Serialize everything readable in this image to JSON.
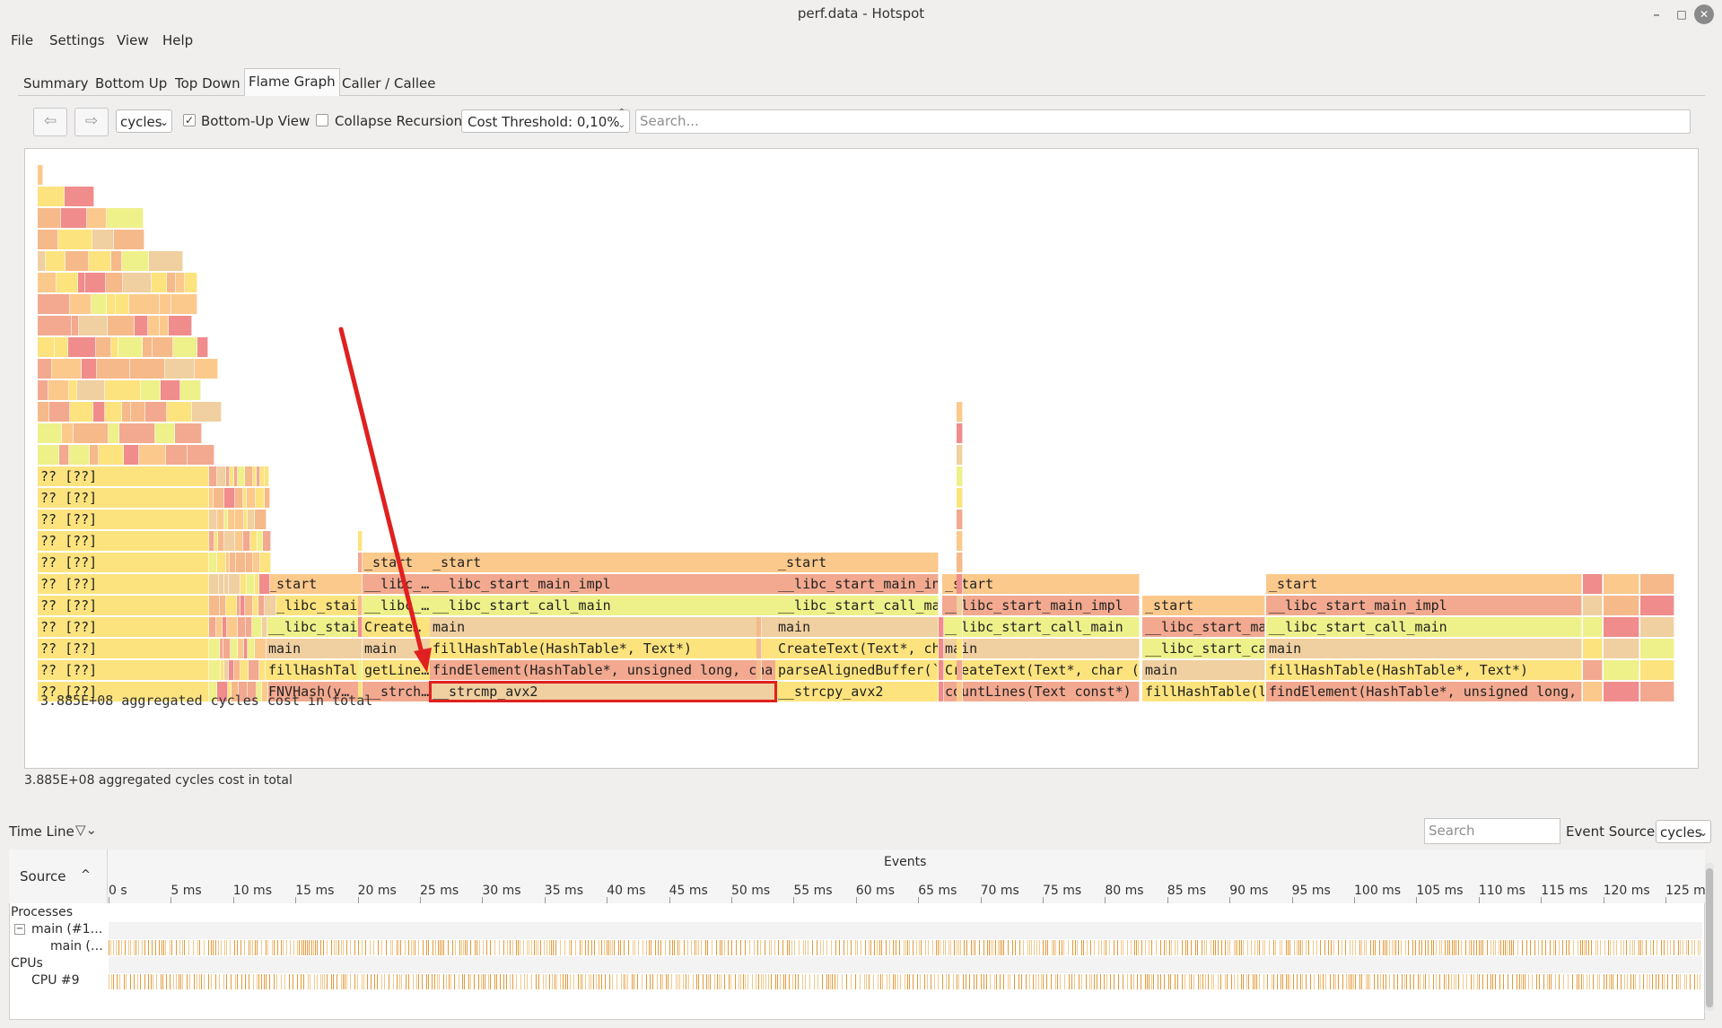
{
  "window": {
    "title": "perf.data - Hotspot",
    "minimize": "–",
    "maximize": "□",
    "close": "✕"
  },
  "menu": [
    "File",
    "Settings",
    "View",
    "Help"
  ],
  "tabs": [
    "Summary",
    "Bottom Up",
    "Top Down",
    "Flame Graph",
    "Caller / Callee"
  ],
  "active_tab": "Flame Graph",
  "toolbar": {
    "back_icon": "⇦",
    "forward_icon": "⇨",
    "event_type": "cycles",
    "bottom_up_view": {
      "label": "Bottom-Up View",
      "checked": true
    },
    "collapse_recursion": {
      "label": "Collapse Recursion",
      "checked": false
    },
    "cost_threshold": "Cost Threshold: 0,10%",
    "search_placeholder": "Search..."
  },
  "flamegraph": {
    "total_inline": "3.885E+08 aggregated cycles cost in total",
    "status": "3.885E+08 aggregated cycles cost in total",
    "colors": {
      "orange": "#fcc98c",
      "salmon": "#f2a98f",
      "yellow": "#fce37e",
      "lime": "#eef08a",
      "tan": "#f0cfa0",
      "red": "#f08c8c",
      "peach": "#f6b98a"
    },
    "frames": [
      {
        "col": 0,
        "row": 0,
        "label": "?? [??]",
        "c": "yellow"
      },
      {
        "col": 0,
        "row": 1,
        "label": "?? [??]",
        "c": "yellow"
      },
      {
        "col": 0,
        "row": 2,
        "label": "?? [??]",
        "c": "yellow"
      },
      {
        "col": 0,
        "row": 3,
        "label": "?? [??]",
        "c": "yellow"
      },
      {
        "col": 0,
        "row": 4,
        "label": "?? [??]",
        "c": "yellow"
      },
      {
        "col": 0,
        "row": 5,
        "label": "?? [??]",
        "c": "yellow"
      },
      {
        "col": 0,
        "row": 6,
        "label": "?? [??]",
        "c": "yellow"
      },
      {
        "col": 0,
        "row": 7,
        "label": "?? [??]",
        "c": "yellow"
      },
      {
        "col": 0,
        "row": 8,
        "label": "?? [??]",
        "c": "yellow"
      },
      {
        "col": 0,
        "row": 9,
        "label": "?? [??]",
        "c": "yellow"
      },
      {
        "col": 0,
        "row": 10,
        "label": "?? [??]",
        "c": "yellow"
      },
      {
        "col": 1,
        "row": 0,
        "label": "FNVHash(v…",
        "c": "salmon"
      },
      {
        "col": 1,
        "row": 1,
        "label": "fillHashTal",
        "c": "yellow"
      },
      {
        "col": 1,
        "row": 2,
        "label": "main",
        "c": "tan"
      },
      {
        "col": 1,
        "row": 3,
        "label": "__libc_stai",
        "c": "lime"
      },
      {
        "col": 1,
        "row": 4,
        "label": "__libc_stai",
        "c": "yellow"
      },
      {
        "col": 1,
        "row": 5,
        "label": "_start",
        "c": "orange"
      },
      {
        "col": 2,
        "row": 0,
        "label": "__strch…",
        "c": "salmon"
      },
      {
        "col": 2,
        "row": 1,
        "label": "getLine…",
        "c": "yellow"
      },
      {
        "col": 2,
        "row": 2,
        "label": "main",
        "c": "tan"
      },
      {
        "col": 2,
        "row": 3,
        "label": "Create…",
        "c": "yellow"
      },
      {
        "col": 2,
        "row": 4,
        "label": "__libc_…",
        "c": "lime"
      },
      {
        "col": 2,
        "row": 5,
        "label": "__libc_…",
        "c": "salmon"
      },
      {
        "col": 2,
        "row": 6,
        "label": "_start",
        "c": "orange"
      },
      {
        "col": 3,
        "row": 0,
        "label": "__strcmp_avx2",
        "c": "tan",
        "highlight": true
      },
      {
        "col": 3,
        "row": 1,
        "label": "findElement(HashTable*, unsigned long, cha",
        "c": "salmon"
      },
      {
        "col": 3,
        "row": 2,
        "label": "fillHashTable(HashTable*, Text*)",
        "c": "yellow"
      },
      {
        "col": 3,
        "row": 3,
        "label": "main",
        "c": "tan"
      },
      {
        "col": 3,
        "row": 4,
        "label": "__libc_start_call_main",
        "c": "lime"
      },
      {
        "col": 3,
        "row": 5,
        "label": "__libc_start_main_impl",
        "c": "salmon"
      },
      {
        "col": 3,
        "row": 6,
        "label": "_start",
        "c": "orange"
      },
      {
        "col": 4,
        "row": 0,
        "label": "__strcpy_avx2",
        "c": "yellow"
      },
      {
        "col": 4,
        "row": 1,
        "label": "parseAlignedBuffer(`",
        "c": "yellow"
      },
      {
        "col": 4,
        "row": 2,
        "label": "CreateText(Text*, ch",
        "c": "yellow"
      },
      {
        "col": 4,
        "row": 3,
        "label": "main",
        "c": "tan"
      },
      {
        "col": 4,
        "row": 4,
        "label": "__libc_start_call_ma",
        "c": "lime"
      },
      {
        "col": 4,
        "row": 5,
        "label": "__libc_start_main_in",
        "c": "salmon"
      },
      {
        "col": 4,
        "row": 6,
        "label": "_start",
        "c": "orange"
      },
      {
        "col": 5,
        "row": 0,
        "label": "countLines(Text const*)",
        "c": "salmon"
      },
      {
        "col": 5,
        "row": 1,
        "label": "CreateText(Text*, char (",
        "c": "yellow"
      },
      {
        "col": 5,
        "row": 2,
        "label": "main",
        "c": "tan"
      },
      {
        "col": 5,
        "row": 3,
        "label": "__libc_start_call_main",
        "c": "lime"
      },
      {
        "col": 5,
        "row": 4,
        "label": "__libc_start_main_impl",
        "c": "salmon"
      },
      {
        "col": 5,
        "row": 5,
        "label": "_start",
        "c": "orange"
      },
      {
        "col": 6,
        "row": 0,
        "label": "fillHashTable(l",
        "c": "yellow"
      },
      {
        "col": 6,
        "row": 1,
        "label": "main",
        "c": "tan"
      },
      {
        "col": 6,
        "row": 2,
        "label": "__libc_start_ca",
        "c": "lime"
      },
      {
        "col": 6,
        "row": 3,
        "label": "__libc_start_ma",
        "c": "salmon"
      },
      {
        "col": 6,
        "row": 4,
        "label": "_start",
        "c": "orange"
      },
      {
        "col": 7,
        "row": 0,
        "label": "findElement(HashTable*, unsigned long,",
        "c": "salmon"
      },
      {
        "col": 7,
        "row": 1,
        "label": "fillHashTable(HashTable*, Text*)",
        "c": "yellow"
      },
      {
        "col": 7,
        "row": 2,
        "label": "main",
        "c": "tan"
      },
      {
        "col": 7,
        "row": 3,
        "label": "__libc_start_call_main",
        "c": "lime"
      },
      {
        "col": 7,
        "row": 4,
        "label": "__libc_start_main_impl",
        "c": "salmon"
      },
      {
        "col": 7,
        "row": 5,
        "label": "_start",
        "c": "orange"
      }
    ]
  },
  "timeline": {
    "label": "Time Line",
    "filter_icon": "▽⌄",
    "search_placeholder": "Search",
    "event_source_label": "Event Source:",
    "event_source": "cycles",
    "source_header": "Source",
    "sort_icon": "^",
    "events_header": "Events",
    "ticks": [
      "0 s",
      "5 ms",
      "10 ms",
      "15 ms",
      "20 ms",
      "25 ms",
      "30 ms",
      "35 ms",
      "40 ms",
      "45 ms",
      "50 ms",
      "55 ms",
      "60 ms",
      "65 ms",
      "70 ms",
      "75 ms",
      "80 ms",
      "85 ms",
      "90 ms",
      "95 ms",
      "100 ms",
      "105 ms",
      "110 ms",
      "115 ms",
      "120 ms",
      "125 ms"
    ],
    "tree": {
      "processes": "Processes",
      "process_row": "main (#1…",
      "thread_row": "main (…",
      "cpus": "CPUs",
      "cpu_row": "CPU #9",
      "collapse_icon": "−"
    }
  }
}
